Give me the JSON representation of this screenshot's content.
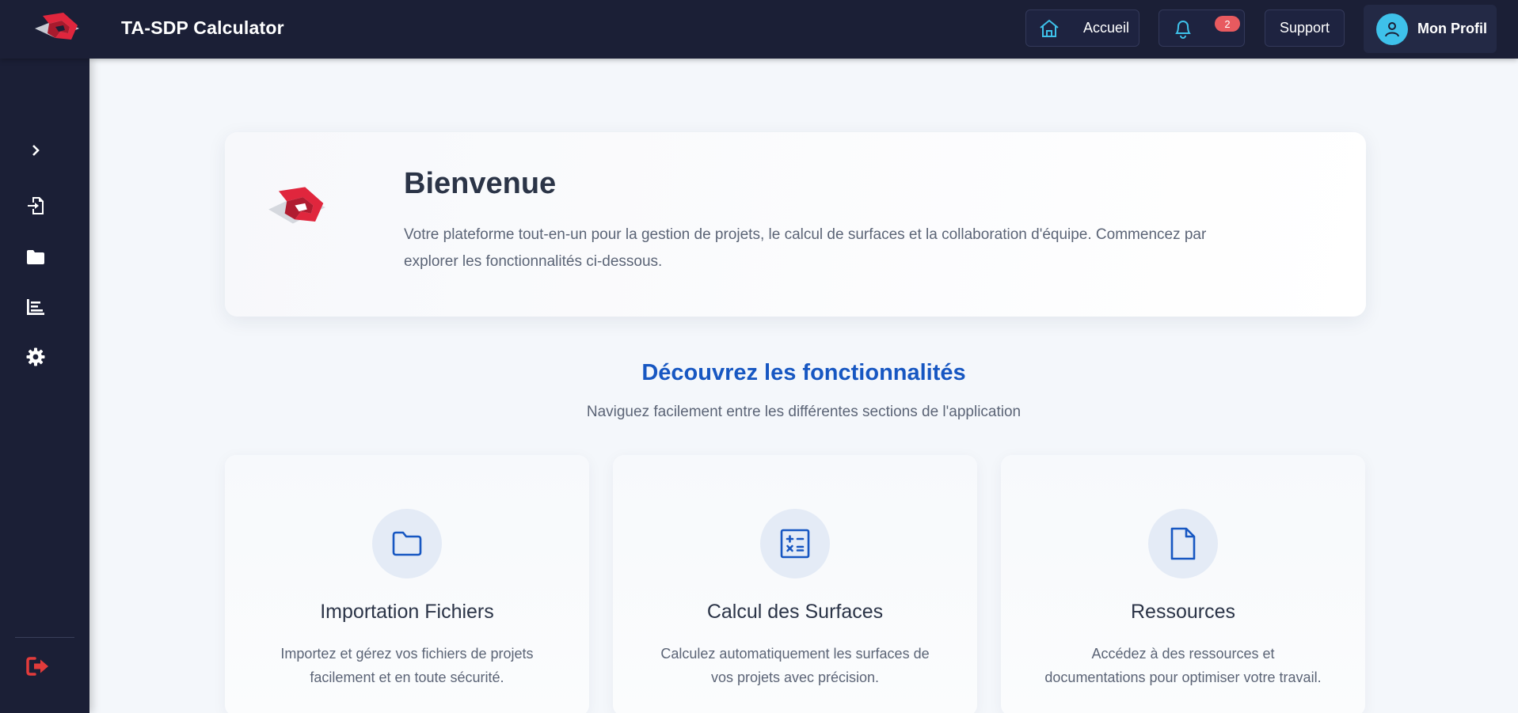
{
  "app": {
    "title": "TA-SDP Calculator"
  },
  "topbar": {
    "home_label": "Accueil",
    "notification_count": "2",
    "support_label": "Support",
    "profile_label": "Mon Profil"
  },
  "sidebar": {
    "items": [
      {
        "icon": "chevron-right-icon"
      },
      {
        "icon": "file-import-icon"
      },
      {
        "icon": "folder-icon"
      },
      {
        "icon": "chart-icon"
      },
      {
        "icon": "gear-icon"
      }
    ],
    "logout_icon": "logout-icon"
  },
  "welcome": {
    "title": "Bienvenue",
    "text": "Votre plateforme tout-en-un pour la gestion de projets, le calcul de surfaces et la collaboration d'équipe. Commencez par explorer les fonctionnalités ci-dessous."
  },
  "features": {
    "title": "Découvrez les fonctionnalités",
    "subtitle": "Naviguez facilement entre les différentes sections de l'application",
    "cards": [
      {
        "icon": "folder-icon",
        "title": "Importation Fichiers",
        "desc": "Importez et gérez vos fichiers de projets facilement et en toute sécurité."
      },
      {
        "icon": "calculator-icon",
        "title": "Calcul des Surfaces",
        "desc": "Calculez automatiquement les surfaces de vos projets avec précision."
      },
      {
        "icon": "document-icon",
        "title": "Ressources",
        "desc": "Accédez à des ressources et documentations pour optimiser votre travail."
      }
    ]
  },
  "colors": {
    "nav_bg": "#1b1f36",
    "accent_blue": "#1757c2",
    "badge_red": "#e85a5f",
    "avatar_cyan": "#3ec1ea",
    "logout_red": "#e23b3b"
  }
}
